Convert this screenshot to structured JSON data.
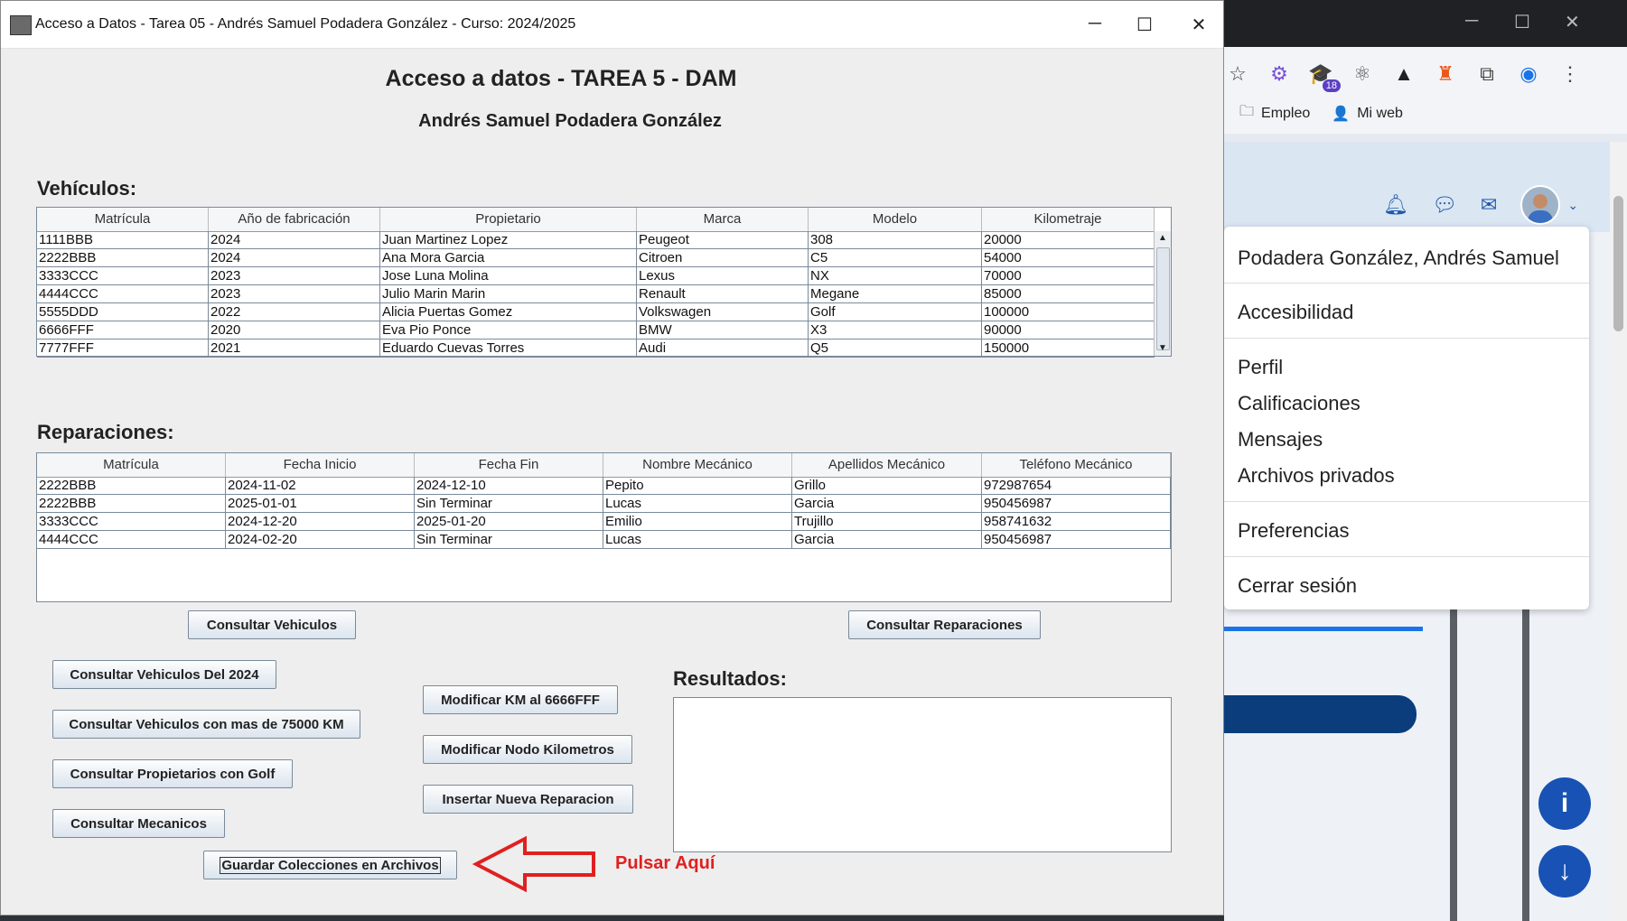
{
  "window": {
    "title": "Acceso a Datos - Tarea 05 - Andrés Samuel Podadera González - Curso: 2024/2025",
    "controls": [
      "minimize",
      "maximize",
      "close"
    ]
  },
  "header": {
    "title": "Acceso a datos - TAREA 5 - DAM",
    "subtitle": "Andrés Samuel Podadera González"
  },
  "vehiculos": {
    "label": "Vehículos:",
    "columns": [
      "Matrícula",
      "Año de fabricación",
      "Propietario",
      "Marca",
      "Modelo",
      "Kilometraje"
    ],
    "rows": [
      [
        "1111BBB",
        "2024",
        "Juan Martinez Lopez",
        "Peugeot",
        "308",
        "20000"
      ],
      [
        "2222BBB",
        "2024",
        "Ana Mora Garcia",
        "Citroen",
        "C5",
        "54000"
      ],
      [
        "3333CCC",
        "2023",
        "Jose Luna Molina",
        "Lexus",
        "NX",
        "70000"
      ],
      [
        "4444CCC",
        "2023",
        "Julio Marin Marin",
        "Renault",
        "Megane",
        "85000"
      ],
      [
        "5555DDD",
        "2022",
        "Alicia Puertas Gomez",
        "Volkswagen",
        "Golf",
        "100000"
      ],
      [
        "6666FFF",
        "2020",
        "Eva Pio Ponce",
        "BMW",
        "X3",
        "90000"
      ],
      [
        "7777FFF",
        "2021",
        "Eduardo Cuevas Torres",
        "Audi",
        "Q5",
        "150000"
      ]
    ]
  },
  "reparaciones": {
    "label": "Reparaciones:",
    "columns": [
      "Matrícula",
      "Fecha Inicio",
      "Fecha Fin",
      "Nombre Mecánico",
      "Apellidos Mecánico",
      "Teléfono Mecánico"
    ],
    "rows": [
      [
        "2222BBB",
        "2024-11-02",
        "2024-12-10",
        "Pepito",
        "Grillo",
        "972987654"
      ],
      [
        "2222BBB",
        "2025-01-01",
        "Sin Terminar",
        "Lucas",
        "Garcia",
        "950456987"
      ],
      [
        "3333CCC",
        "2024-12-20",
        "2025-01-20",
        "Emilio",
        "Trujillo",
        "958741632"
      ],
      [
        "4444CCC",
        "2024-02-20",
        "Sin Terminar",
        "Lucas",
        "Garcia",
        "950456987"
      ]
    ]
  },
  "buttons": {
    "consultar_vehiculos": "Consultar Vehiculos",
    "consultar_reparaciones": "Consultar Reparaciones",
    "vehiculos_2024": "Consultar Vehiculos Del 2024",
    "vehiculos_75000": "Consultar Vehiculos con mas de 75000 KM",
    "propietarios_golf": "Consultar Propietarios con Golf",
    "consultar_mecanicos": "Consultar Mecanicos",
    "modificar_km": "Modificar KM al 6666FFF",
    "modificar_nodo": "Modificar Nodo Kilometros",
    "insertar_reparacion": "Insertar Nueva Reparacion",
    "guardar_colecciones": "Guardar Colecciones en Archivos"
  },
  "resultados": {
    "label": "Resultados:",
    "value": ""
  },
  "annotation": {
    "text": "Pulsar Aquí",
    "color": "#e02020"
  },
  "browser": {
    "bookmarks": [
      "Empleo",
      "Mi web"
    ],
    "extension_badge": "18",
    "user_menu": {
      "name": "Podadera González, Andrés Samuel",
      "items": [
        "Accesibilidad",
        "Perfil",
        "Calificaciones",
        "Mensajes",
        "Archivos privados",
        "Preferencias",
        "Cerrar sesión"
      ]
    },
    "fab_info": "i",
    "fab_down": "↓"
  }
}
